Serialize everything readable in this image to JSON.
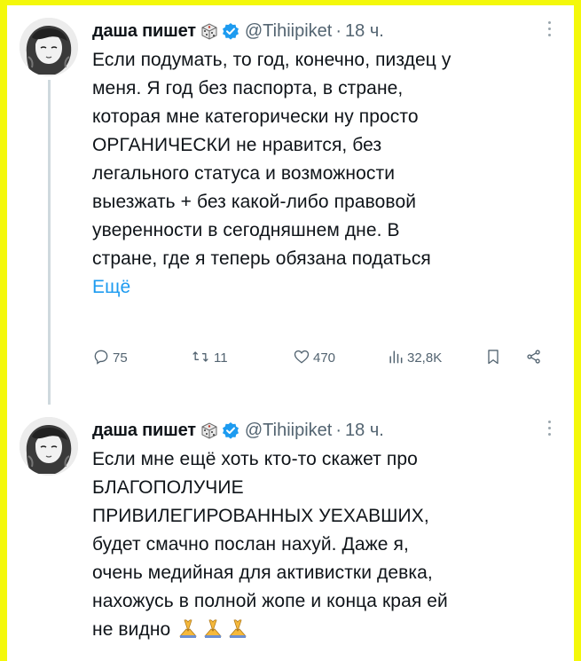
{
  "tweets": [
    {
      "author_name": "даша пишет",
      "handle": "@Tihiipiket",
      "separator": "·",
      "time": "18 ч.",
      "lines": [
        "Если подумать, то год, конечно, пиздец у",
        "меня. Я год без паспорта, в стране,",
        "которая мне категорически ну просто",
        "ОРГАНИЧЕСКИ не нравится, без",
        "легального статуса и возможности",
        "выезжать + без какой-либо правовой",
        "уверенности в сегодняшнем дне. В",
        "стране, где я теперь обязана податься"
      ],
      "show_more": "Ещё",
      "actions": {
        "replies": "75",
        "reposts": "11",
        "likes": "470",
        "views": "32,8K"
      }
    },
    {
      "author_name": "даша пишет",
      "handle": "@Tihiipiket",
      "separator": "·",
      "time": "18 ч.",
      "lines": [
        "Если мне ещё хоть кто-то скажет про",
        "БЛАГОПОЛУЧИЕ",
        "ПРИВИЛЕГИРОВАННЫХ УЕХАВШИХ,",
        "будет смачно послан нахуй. Даже я,",
        "очень медийная для активистки девка,",
        "нахожусь в полной жопе и конца края ей",
        "не видно"
      ],
      "trailing_emoji": "🙏🙏🙏"
    }
  ],
  "colors": {
    "frame": "#f4f80a",
    "link": "#1d9bf0",
    "verified": "#1d9bf0",
    "secondary_text": "#536471"
  },
  "icons": [
    "dice-icon",
    "verified-badge-icon",
    "more-icon",
    "reply-icon",
    "repost-icon",
    "like-icon",
    "views-icon",
    "bookmark-icon",
    "share-icon",
    "pray-hands-icon"
  ]
}
